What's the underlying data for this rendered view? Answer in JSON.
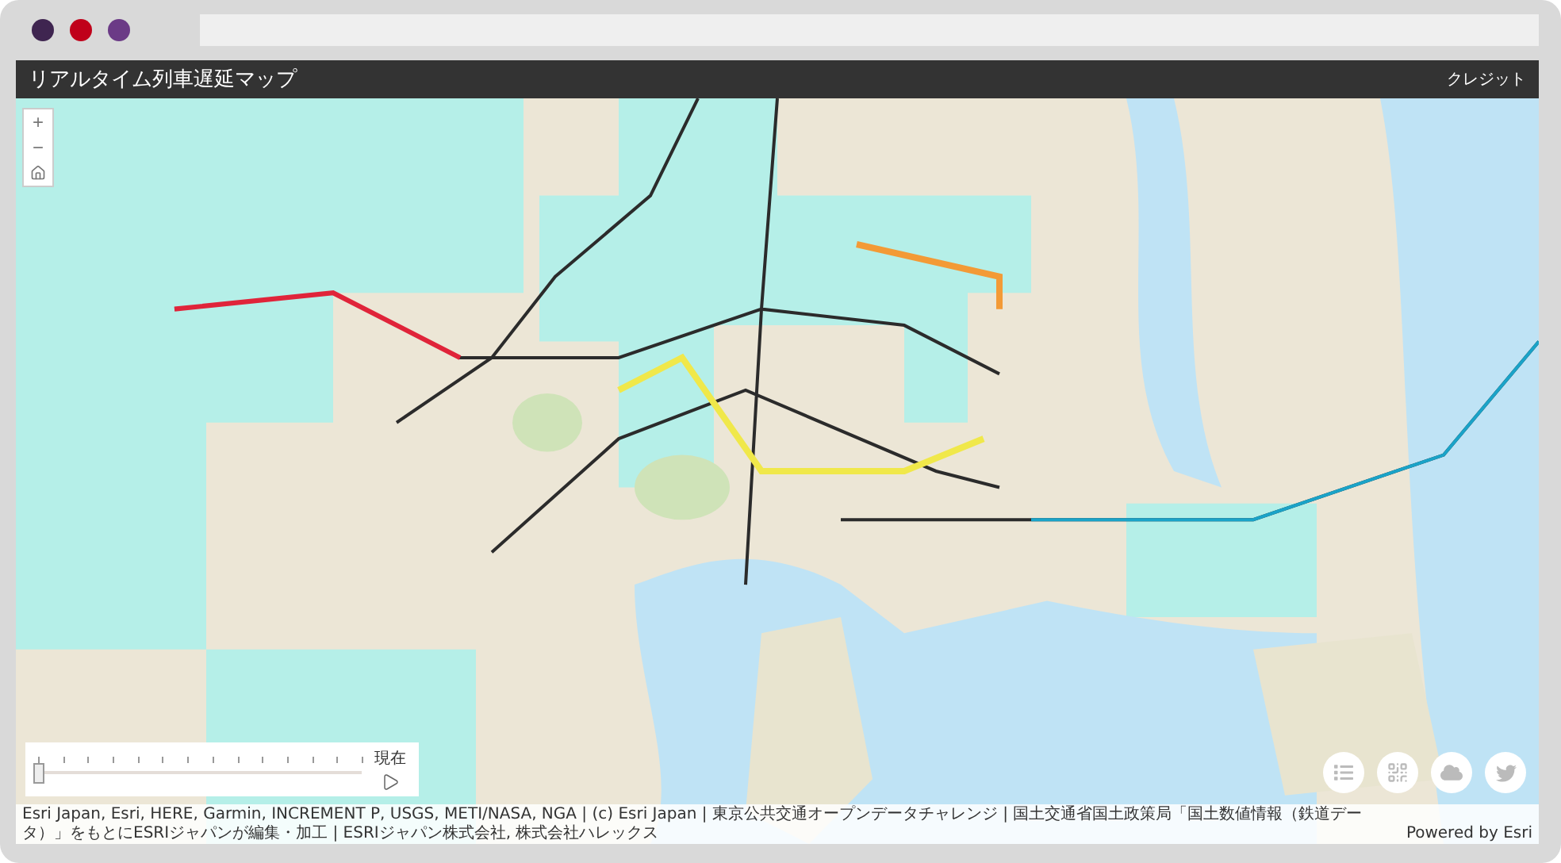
{
  "window": {
    "dots": [
      {
        "color": "#3f2550"
      },
      {
        "color": "#c0001a"
      },
      {
        "color": "#6b3a86"
      }
    ]
  },
  "header": {
    "title": "リアルタイム列車遅延マップ",
    "credit_link": "クレジット"
  },
  "map": {
    "kind": "picture",
    "zoom_in": "+",
    "zoom_out": "−"
  },
  "timeline": {
    "level": 0,
    "label": "現在"
  },
  "actions": [
    {
      "kind": "list"
    },
    {
      "kind": "grid"
    },
    {
      "kind": "cloud"
    },
    {
      "kind": "bird"
    }
  ],
  "attribution": {
    "text": "Esri Japan, Esri, HERE, Garmin, INCREMENT P, USGS, METI/NASA, NGA | (c) Esri Japan | 東京公共交通オープンデータチャレンジ | 国土交通省国土政策局「国土数値情報（鉄道データ）」をもとにESRIジャパンが編集・加工 | ESRIジャパン株式会社, 株式会社ハレックス",
    "powered_by": "Powered by Esri"
  }
}
